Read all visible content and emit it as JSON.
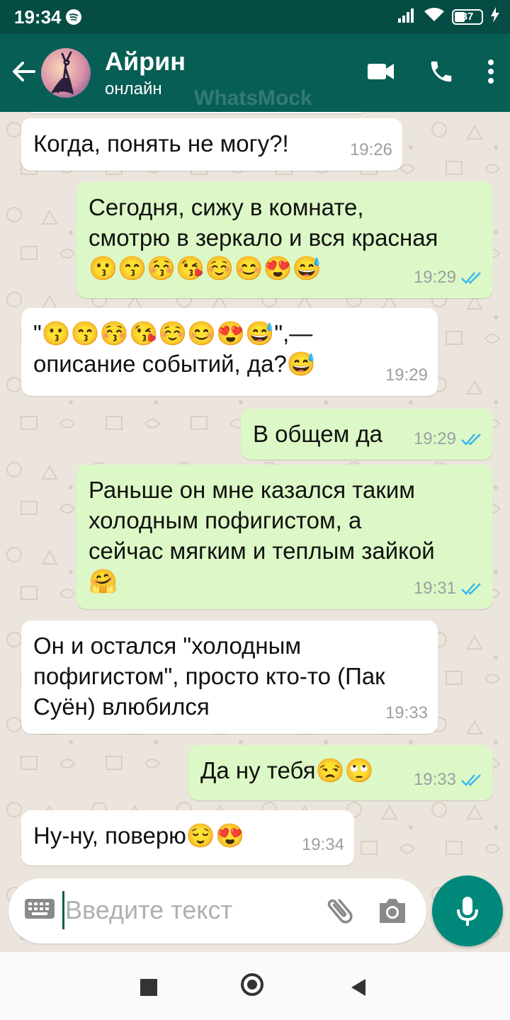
{
  "status_bar": {
    "time": "19:34",
    "battery": "37"
  },
  "header": {
    "name": "Айрин",
    "status": "онлайн",
    "watermark": "WhatsMock"
  },
  "messages": [
    {
      "dir": "in",
      "text": "Когда, понять не могу?!",
      "time": "19:26"
    },
    {
      "dir": "out",
      "text": "Сегодня, сижу в комнате,\nсмотрю в зеркало и вся красная\n😗😙😚😘☺️😊😍😅",
      "time": "19:29",
      "read": true
    },
    {
      "dir": "in",
      "text": "\"😗😙😚😘☺️😊😍😅\",—\nописание событий, да?😅",
      "time": "19:29"
    },
    {
      "dir": "out",
      "text": "В общем да",
      "time": "19:29",
      "read": true
    },
    {
      "dir": "out",
      "text": "Раньше он мне казался таким\nхолодным пофигистом, а\nсейчас мягким и теплым зайкой\n🤗",
      "time": "19:31",
      "read": true
    },
    {
      "dir": "in",
      "text": "Он и остался \"холодным\nпофигистом\", просто кто-то (Пак\nСуён) влюбился",
      "time": "19:33"
    },
    {
      "dir": "out",
      "text": "Да ну тебя😒🙄",
      "time": "19:33",
      "read": true
    },
    {
      "dir": "in",
      "text": "Ну-ну, поверю😌😍",
      "time": "19:34"
    }
  ],
  "composer": {
    "placeholder": "Введите текст"
  },
  "colors": {
    "header": "#075e54",
    "statusbar": "#054d44",
    "outgoing": "#dcf8c6",
    "incoming": "#ffffff",
    "tick": "#34b7f1",
    "mic": "#00897b"
  }
}
